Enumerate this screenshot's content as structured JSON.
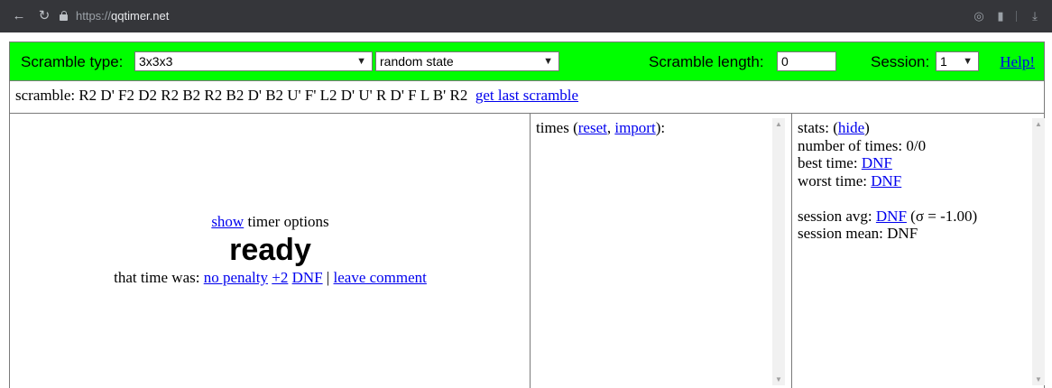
{
  "browser": {
    "url_protocol": "https://",
    "url_host": "qqtimer.net"
  },
  "controls": {
    "scramble_type_label": "Scramble type:",
    "scramble_type_value": "3x3x3",
    "scramble_mode_value": "random state",
    "scramble_length_label": "Scramble length:",
    "scramble_length_value": "0",
    "session_label": "Session:",
    "session_value": "1",
    "help_label": "Help!"
  },
  "scramble": {
    "text": "scramble: R2 D' F2 D2 R2 B2 R2 B2 D' B2 U' F' L2 D' U' R D' F L B' R2",
    "get_last_label": "get last scramble"
  },
  "timer": {
    "show_label": "show",
    "options_suffix": " timer options",
    "ready_text": "ready",
    "that_time_label": "that time was: ",
    "no_penalty_label": "no penalty",
    "plus2_label": "+2",
    "dnf_label": "DNF",
    "pipe": " | ",
    "leave_comment_label": "leave comment"
  },
  "times": {
    "prefix": "times (",
    "reset_label": "reset",
    "comma": ", ",
    "import_label": "import",
    "suffix": "):"
  },
  "stats": {
    "prefix": "stats: (",
    "hide_label": "hide",
    "close_paren": ")",
    "num_times": "number of times: 0/0",
    "best_label": "best time: ",
    "best_value": "DNF",
    "worst_label": "worst time: ",
    "worst_value": "DNF",
    "avg_label": "session avg: ",
    "avg_value": "DNF",
    "avg_sigma": " (σ = -1.00)",
    "mean": "session mean: DNF"
  }
}
